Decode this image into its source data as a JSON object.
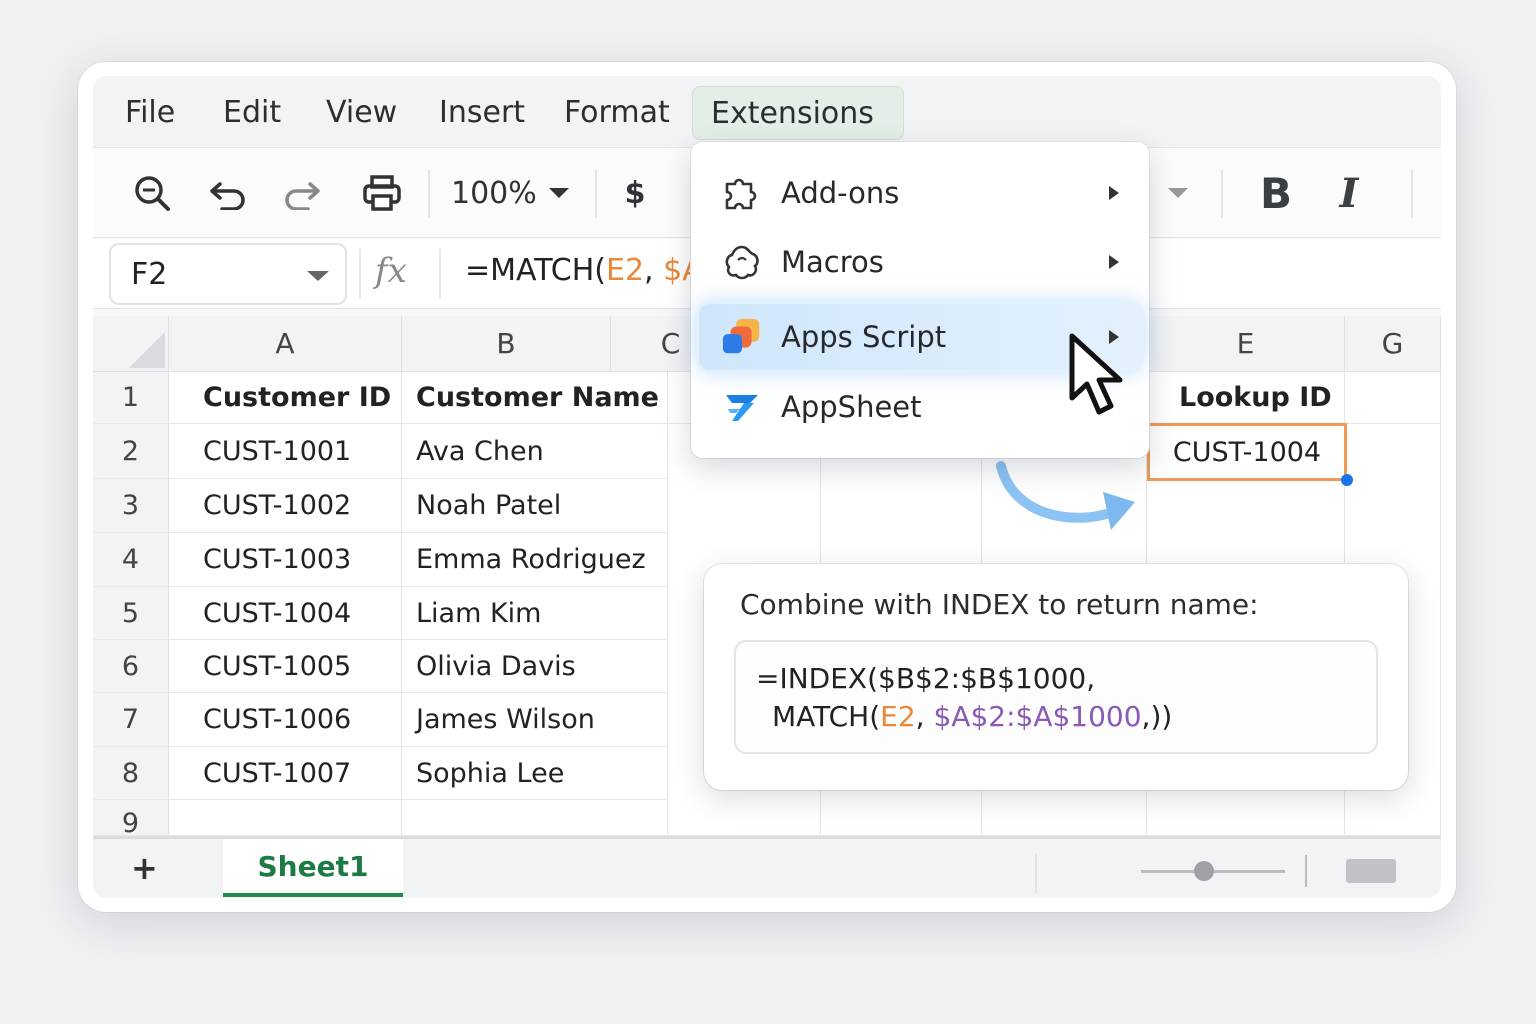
{
  "menu": [
    "File",
    "Edit",
    "View",
    "Insert",
    "Format",
    "Extensions"
  ],
  "toolbar": {
    "zoom": "100%",
    "currency": "$",
    "bold": "B",
    "italic": "I"
  },
  "formula_bar": {
    "cell_ref": "F2",
    "fx": "fx",
    "formula_prefix": "=MATCH(",
    "formula_arg1": "E2",
    "formula_sep": ", ",
    "formula_arg2": "$A"
  },
  "columns": [
    "A",
    "B",
    "C",
    "E",
    "G"
  ],
  "rows": [
    "1",
    "2",
    "3",
    "4",
    "5",
    "6",
    "7",
    "8",
    "9"
  ],
  "headers": {
    "customer_id": "Customer ID",
    "customer_name": "Customer Name",
    "lookup_id": "Lookup ID"
  },
  "data": [
    {
      "id": "CUST-1001",
      "name": "Ava Chen"
    },
    {
      "id": "CUST-1002",
      "name": "Noah Patel"
    },
    {
      "id": "CUST-1003",
      "name": "Emma Rodriguez"
    },
    {
      "id": "CUST-1004",
      "name": "Liam Kim"
    },
    {
      "id": "CUST-1005",
      "name": "Olivia Davis"
    },
    {
      "id": "CUST-1006",
      "name": "James Wilson"
    },
    {
      "id": "CUST-1007",
      "name": "Sophia Lee"
    }
  ],
  "lookup_value": "CUST-1004",
  "extensions_menu": [
    {
      "label": "Add-ons",
      "icon": "puzzle-icon"
    },
    {
      "label": "Macros",
      "icon": "macros-icon"
    },
    {
      "label": "Apps Script",
      "icon": "apps-script-icon"
    },
    {
      "label": "AppSheet",
      "icon": "appsheet-icon"
    }
  ],
  "callout": {
    "title": "Combine with INDEX to return name:",
    "line1": "=INDEX($B$2:$B$1000,",
    "line2_prefix": "MATCH(",
    "line2_arg1": "E2",
    "line2_sep": ", ",
    "line2_arg2": "$A$2:$A$1000",
    "line2_suffix": ",))"
  },
  "sheet_tab": "Sheet1",
  "add_sheet": "+",
  "colors": {
    "accent_green": "#1e8a4c",
    "selection": "#ee9a55",
    "arg_orange": "#e8893a",
    "arg_purple": "#8a59b8",
    "highlight_blue": "#cfe6fb"
  }
}
